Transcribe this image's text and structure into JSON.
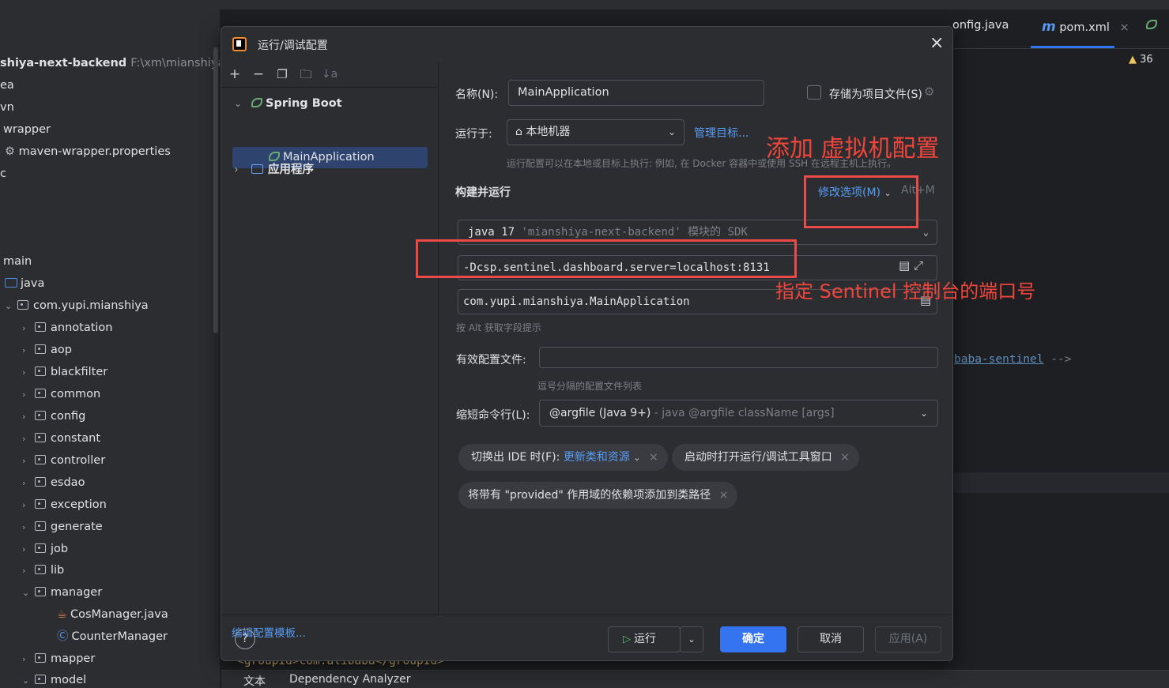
{
  "ide": {
    "project_tree": [
      {
        "text": "shiya-next-backend",
        "extra": "F:\\xm\\mianshiya-ba",
        "bold": true
      },
      {
        "text": "ea"
      },
      {
        "text": "vn"
      },
      {
        "text": "wrapper"
      },
      {
        "text": "maven-wrapper.properties",
        "icon": "settings-file-icon"
      },
      {
        "text": "c"
      },
      {
        "text": ""
      },
      {
        "text": ""
      },
      {
        "text": "main"
      },
      {
        "text": "java",
        "icon": "folder-icon"
      },
      {
        "text": "com.yupi.mianshiya",
        "icon": "package-icon"
      },
      {
        "text": "annotation",
        "icon": "package-icon"
      },
      {
        "text": "aop",
        "icon": "package-icon"
      },
      {
        "text": "blackfilter",
        "icon": "package-icon"
      },
      {
        "text": "common",
        "icon": "package-icon"
      },
      {
        "text": "config",
        "icon": "package-icon"
      },
      {
        "text": "constant",
        "icon": "package-icon"
      },
      {
        "text": "controller",
        "icon": "package-icon"
      },
      {
        "text": "esdao",
        "icon": "package-icon"
      },
      {
        "text": "exception",
        "icon": "package-icon"
      },
      {
        "text": "generate",
        "icon": "package-icon"
      },
      {
        "text": "job",
        "icon": "package-icon"
      },
      {
        "text": "lib",
        "icon": "package-icon"
      },
      {
        "text": "manager",
        "icon": "package-icon"
      },
      {
        "text": "CosManager.java",
        "icon": "java-file-icon"
      },
      {
        "text": "CounterManager",
        "icon": "class-icon"
      },
      {
        "text": "mapper",
        "icon": "package-icon"
      },
      {
        "text": "model",
        "icon": "package-icon"
      }
    ],
    "editor_tabs": {
      "config_tab": "onfig.java",
      "pom_tab_prefix": "m",
      "pom_tab": "pom.xml",
      "pom_close": "×"
    },
    "warning_count": "36",
    "bg_code_tag": "baba-sentinel",
    "bg_code_tail": " -->",
    "bg_bottom_code": "<groupId>com.alibaba</groupId>",
    "bottom_tabs": {
      "text": "文本",
      "dependency": "Dependency Analyzer"
    }
  },
  "dialog": {
    "title": "运行/调试配置",
    "close": "×",
    "toolbar": {
      "add": "+",
      "remove": "−",
      "copy": "❐",
      "folder": "🗀",
      "sort": "↓a"
    },
    "tree": {
      "spring_boot": "Spring Boot",
      "main_app": "MainApplication",
      "application": "应用程序"
    },
    "edit_templates": "编辑配置模板...",
    "form": {
      "name_label": "名称(N):",
      "name_value": "MainApplication",
      "store_label": "存储为项目文件(S)",
      "run_on_label": "运行于:",
      "run_on_value": "本地机器",
      "manage_targets": "管理目标...",
      "run_on_hint": "运行配置可以在本地或目标上执行: 例如, 在 Docker 容器中或使用 SSH 在远程主机上执行。",
      "build_run_heading": "构建并运行",
      "modify_options": "修改选项(M)",
      "modify_shortcut": "Alt+M",
      "sdk_java": "java 17",
      "sdk_module": "'mianshiya-next-backend' 模块的 SDK",
      "vm_options": "-Dcsp.sentinel.dashboard.server=localhost:8131",
      "main_class": "com.yupi.mianshiya.MainApplication",
      "alt_hint": "按 Alt 获取字段提示",
      "profiles_label": "有效配置文件:",
      "profiles_value": "",
      "profiles_hint": "逗号分隔的配置文件列表",
      "shorten_label": "缩短命令行(L):",
      "shorten_value": "@argfile (Java 9+)",
      "shorten_sub": " - java @argfile className [args]",
      "chip_frame_prefix": "切换出 IDE 时(F): ",
      "chip_frame_link": "更新类和资源",
      "chip_open_toolwin": "启动时打开运行/调试工具窗口",
      "chip_provided": "将带有 \"provided\" 作用域的依赖项添加到类路径",
      "chip_close": "×"
    },
    "buttons": {
      "help": "?",
      "run": "运行",
      "ok": "确定",
      "cancel": "取消",
      "apply": "应用(A)"
    }
  },
  "annotations": {
    "add_vm_config": "添加 虚拟机配置",
    "sentinel_port": "指定 Sentinel 控制台的端口号"
  },
  "colors": {
    "accent": "#3574f0",
    "annotation_red": "#ec4a48",
    "link": "#589df6",
    "selection": "#2e436e"
  }
}
